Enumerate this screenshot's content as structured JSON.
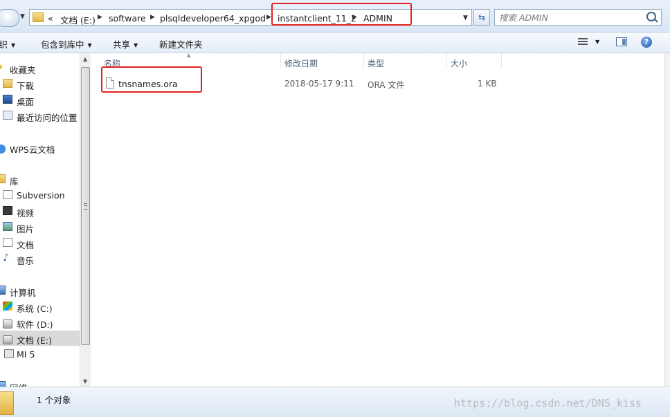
{
  "address": {
    "overflow_mark": "«",
    "crumbs": [
      "文档 (E:)",
      "software",
      "plsqldeveloper64_xpgod",
      "instantclient_11_2",
      "ADMIN"
    ],
    "search_placeholder": "搜索 ADMIN"
  },
  "toolbar": {
    "organize": "组织",
    "include_in_library": "包含到库中",
    "share": "共享",
    "new_folder": "新建文件夹"
  },
  "nav": {
    "favorites": "收藏夹",
    "downloads": "下载",
    "desktop": "桌面",
    "recent": "最近访问的位置",
    "wps_cloud": "WPS云文档",
    "libraries": "库",
    "subversion": "Subversion",
    "videos": "视频",
    "pictures": "图片",
    "documents": "文档",
    "music": "音乐",
    "computer": "计算机",
    "drive_c": "系统 (C:)",
    "drive_d": "软件 (D:)",
    "drive_e": "文档 (E:)",
    "mi5": "MI 5",
    "network": "网络"
  },
  "columns": {
    "name": "名称",
    "modified": "修改日期",
    "type": "类型",
    "size": "大小"
  },
  "files": [
    {
      "name": "tnsnames.ora",
      "modified": "2018-05-17 9:11",
      "type": "ORA 文件",
      "size": "1 KB"
    }
  ],
  "status": {
    "count": "1 个对象"
  },
  "watermark": "https://blog.csdn.net/DNS_kiss",
  "colors": {
    "highlight": "#e02020",
    "selected_nav": "#d9d9d9",
    "header_text": "#4c607a"
  }
}
